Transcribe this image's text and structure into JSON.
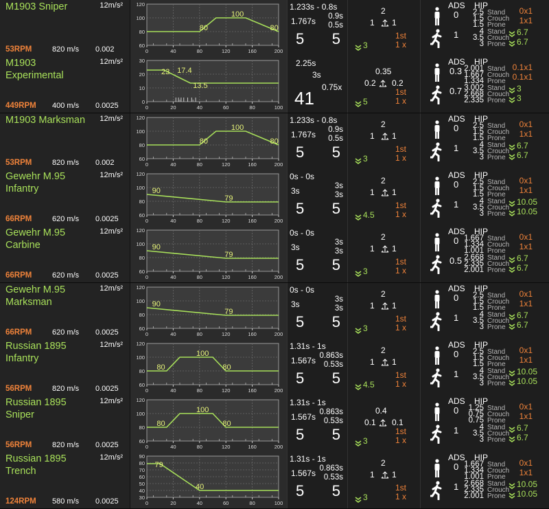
{
  "headers": {
    "ads": "ADS",
    "hip": "HIP",
    "stand": "Stand",
    "crouch": "Crouch",
    "prone": "Prone"
  },
  "weapons": [
    {
      "name": "M1903 Sniper",
      "accel": "12m/s²",
      "rpm": "53RPM",
      "velocity": "820 m/s",
      "drag": "0.002",
      "chart": {
        "xmax": 200,
        "yticks": [
          "120",
          "100",
          "80",
          "60"
        ],
        "xticks": [
          "0",
          "40",
          "80",
          "120",
          "160",
          "200"
        ],
        "ymin": 60,
        "ymax": 120,
        "points": [
          [
            0,
            80
          ],
          [
            80,
            80
          ],
          [
            105,
            100
          ],
          [
            150,
            100
          ],
          [
            200,
            80
          ]
        ],
        "labels": [
          {
            "text": "80",
            "x": 80,
            "y": 80
          },
          {
            "text": "100",
            "x": 128,
            "y": 100
          },
          {
            "text": "80",
            "x": 187,
            "y": 80
          }
        ],
        "minor": []
      },
      "dmg": {
        "reload": "1.233s - 0.8s",
        "deploy": "1.767s",
        "a": "0.9s",
        "b": "0.5s",
        "mag": "5",
        "ammo": "5"
      },
      "recoil": {
        "up": "2",
        "left": "1",
        "right": "1",
        "first_shot": "1st",
        "first_mult": "1 x",
        "chevron_val": "3"
      },
      "spread": {
        "ads_stand": "0",
        "ads_move": "1",
        "hip": [
          [
            "2.5",
            "1.5",
            "1.5"
          ],
          [
            "4",
            "3.5",
            "3"
          ]
        ],
        "inc_stand": "0x1",
        "inc_crouch": "1x1",
        "inc_move_a": "6.7",
        "inc_move_b": "6.7"
      }
    },
    {
      "name": "M1903\nExperimental",
      "accel": "12m/s²",
      "rpm": "449RPM",
      "velocity": "400 m/s",
      "drag": "0.0025",
      "chart": {
        "xmax": 100,
        "yticks": [
          "30",
          "20",
          "10",
          "0"
        ],
        "xticks": [
          "0",
          "20",
          "40",
          "60",
          "80",
          "100"
        ],
        "ymin": 0,
        "ymax": 30,
        "points": [
          [
            0,
            23
          ],
          [
            13,
            23
          ],
          [
            33,
            13.5
          ],
          [
            100,
            13.5
          ]
        ],
        "labels": [
          {
            "text": "23",
            "x": 11,
            "y": 19
          },
          {
            "text": "17.4",
            "x": 23,
            "y": 20
          },
          {
            "text": "13.5",
            "x": 35,
            "y": 9
          }
        ],
        "minor": [
          22,
          24,
          26,
          28,
          31,
          34,
          37
        ]
      },
      "dmg": {
        "reload": "2.25s",
        "deploy": "3s",
        "a": "41",
        "b": "0.75x",
        "mag": "",
        "ammo": ""
      },
      "recoil": {
        "up": "0.35",
        "left": "0.2",
        "right": "0.2",
        "first_shot": "1st",
        "first_mult": "1 x",
        "chevron_val": "5"
      },
      "spread": {
        "ads_stand": "0.3",
        "ads_move": "0.7",
        "hip": [
          [
            "2.001",
            "1.667",
            "1.334"
          ],
          [
            "3.002",
            "2.668",
            "2.335"
          ]
        ],
        "inc_stand": "0.1x1",
        "inc_crouch": "0.1x1",
        "inc_move_a": "3",
        "inc_move_b": "3"
      }
    },
    {
      "name": "M1903 Marksman",
      "accel": "12m/s²",
      "rpm": "53RPM",
      "velocity": "820 m/s",
      "drag": "0.002",
      "chart": {
        "xmax": 200,
        "yticks": [
          "120",
          "100",
          "80",
          "60"
        ],
        "xticks": [
          "0",
          "40",
          "80",
          "120",
          "160",
          "200"
        ],
        "ymin": 60,
        "ymax": 120,
        "points": [
          [
            0,
            80
          ],
          [
            80,
            80
          ],
          [
            105,
            100
          ],
          [
            150,
            100
          ],
          [
            200,
            80
          ]
        ],
        "labels": [
          {
            "text": "80",
            "x": 80,
            "y": 80
          },
          {
            "text": "100",
            "x": 128,
            "y": 100
          },
          {
            "text": "80",
            "x": 187,
            "y": 80
          }
        ],
        "minor": []
      },
      "dmg": {
        "reload": "1.233s - 0.8s",
        "deploy": "1.767s",
        "a": "0.9s",
        "b": "0.5s",
        "mag": "5",
        "ammo": "5"
      },
      "recoil": {
        "up": "2",
        "left": "1",
        "right": "1",
        "first_shot": "1st",
        "first_mult": "1 x",
        "chevron_val": "3"
      },
      "spread": {
        "ads_stand": "0",
        "ads_move": "1",
        "hip": [
          [
            "2.5",
            "1.5",
            "1.5"
          ],
          [
            "4",
            "3.5",
            "3"
          ]
        ],
        "inc_stand": "0x1",
        "inc_crouch": "1x1",
        "inc_move_a": "6.7",
        "inc_move_b": "6.7"
      }
    },
    {
      "name": "Gewehr M.95\nInfantry",
      "accel": "12m/s²",
      "rpm": "66RPM",
      "velocity": "620 m/s",
      "drag": "0.0025",
      "chart": {
        "xmax": 200,
        "yticks": [
          "120",
          "100",
          "80",
          "60"
        ],
        "xticks": [
          "0",
          "40",
          "80",
          "120",
          "160",
          "200"
        ],
        "ymin": 60,
        "ymax": 120,
        "points": [
          [
            0,
            90
          ],
          [
            120,
            79
          ],
          [
            200,
            79
          ]
        ],
        "labels": [
          {
            "text": "90",
            "x": 8,
            "y": 90
          },
          {
            "text": "79",
            "x": 118,
            "y": 79
          }
        ],
        "minor": []
      },
      "dmg": {
        "reload": "0s - 0s",
        "deploy": "3s",
        "a": "3s",
        "b": "3s",
        "mag": "5",
        "ammo": "5"
      },
      "recoil": {
        "up": "2",
        "left": "1",
        "right": "1",
        "first_shot": "1st",
        "first_mult": "1 x",
        "chevron_val": "4.5"
      },
      "spread": {
        "ads_stand": "0",
        "ads_move": "1",
        "hip": [
          [
            "2.5",
            "1.5",
            "1.5"
          ],
          [
            "4",
            "3.5",
            "3"
          ]
        ],
        "inc_stand": "0x1",
        "inc_crouch": "1x1",
        "inc_move_a": "10.05",
        "inc_move_b": "10.05"
      }
    },
    {
      "name": "Gewehr M.95\nCarbine",
      "accel": "12m/s²",
      "rpm": "66RPM",
      "velocity": "620 m/s",
      "drag": "0.0025",
      "chart": {
        "xmax": 200,
        "yticks": [
          "120",
          "100",
          "80",
          "60"
        ],
        "xticks": [
          "0",
          "40",
          "80",
          "120",
          "160",
          "200"
        ],
        "ymin": 60,
        "ymax": 120,
        "points": [
          [
            0,
            90
          ],
          [
            120,
            79
          ],
          [
            200,
            79
          ]
        ],
        "labels": [
          {
            "text": "90",
            "x": 8,
            "y": 90
          },
          {
            "text": "79",
            "x": 118,
            "y": 79
          }
        ],
        "minor": []
      },
      "dmg": {
        "reload": "0s - 0s",
        "deploy": "3s",
        "a": "3s",
        "b": "3s",
        "mag": "5",
        "ammo": "5"
      },
      "recoil": {
        "up": "2",
        "left": "1",
        "right": "1",
        "first_shot": "1st",
        "first_mult": "1 x",
        "chevron_val": "3"
      },
      "spread": {
        "ads_stand": "0",
        "ads_move": "0.5",
        "hip": [
          [
            "1.667",
            "1.334",
            "1.001"
          ],
          [
            "2.668",
            "2.335",
            "2.001"
          ]
        ],
        "inc_stand": "0x1",
        "inc_crouch": "1x1",
        "inc_move_a": "6.7",
        "inc_move_b": "6.7"
      }
    },
    {
      "name": "Gewehr M.95\nMarksman",
      "accel": "12m/s²",
      "rpm": "66RPM",
      "velocity": "620 m/s",
      "drag": "0.0025",
      "chart": {
        "xmax": 200,
        "yticks": [
          "120",
          "100",
          "80",
          "60"
        ],
        "xticks": [
          "0",
          "40",
          "80",
          "120",
          "160",
          "200"
        ],
        "ymin": 60,
        "ymax": 120,
        "points": [
          [
            0,
            90
          ],
          [
            120,
            79
          ],
          [
            200,
            79
          ]
        ],
        "labels": [
          {
            "text": "90",
            "x": 8,
            "y": 90
          },
          {
            "text": "79",
            "x": 118,
            "y": 79
          }
        ],
        "minor": []
      },
      "dmg": {
        "reload": "0s - 0s",
        "deploy": "3s",
        "a": "3s",
        "b": "3s",
        "mag": "5",
        "ammo": "5"
      },
      "recoil": {
        "up": "2",
        "left": "1",
        "right": "1",
        "first_shot": "1st",
        "first_mult": "1 x",
        "chevron_val": "3"
      },
      "spread": {
        "ads_stand": "0",
        "ads_move": "1",
        "hip": [
          [
            "2.5",
            "1.5",
            "1.5"
          ],
          [
            "4",
            "3.5",
            "3"
          ]
        ],
        "inc_stand": "0x1",
        "inc_crouch": "1x1",
        "inc_move_a": "6.7",
        "inc_move_b": "6.7"
      }
    },
    {
      "name": "Russian 1895\nInfantry",
      "accel": "12m/s²",
      "rpm": "56RPM",
      "velocity": "820 m/s",
      "drag": "0.0025",
      "chart": {
        "xmax": 200,
        "yticks": [
          "120",
          "100",
          "80",
          "60"
        ],
        "xticks": [
          "0",
          "40",
          "80",
          "120",
          "160",
          "200"
        ],
        "ymin": 60,
        "ymax": 120,
        "points": [
          [
            0,
            80
          ],
          [
            30,
            80
          ],
          [
            50,
            100
          ],
          [
            100,
            100
          ],
          [
            120,
            80
          ],
          [
            200,
            80
          ]
        ],
        "labels": [
          {
            "text": "80",
            "x": 15,
            "y": 80
          },
          {
            "text": "100",
            "x": 75,
            "y": 100
          },
          {
            "text": "80",
            "x": 115,
            "y": 80
          }
        ],
        "minor": []
      },
      "dmg": {
        "reload": "1.31s - 1s",
        "deploy": "1.567s",
        "a": "0.863s",
        "b": "0.53s",
        "mag": "5",
        "ammo": "5"
      },
      "recoil": {
        "up": "2",
        "left": "1",
        "right": "1",
        "first_shot": "1st",
        "first_mult": "1 x",
        "chevron_val": "4.5"
      },
      "spread": {
        "ads_stand": "0",
        "ads_move": "1",
        "hip": [
          [
            "2.5",
            "1.5",
            "1.5"
          ],
          [
            "4",
            "3.5",
            "3"
          ]
        ],
        "inc_stand": "0x1",
        "inc_crouch": "1x1",
        "inc_move_a": "10.05",
        "inc_move_b": "10.05"
      }
    },
    {
      "name": "Russian 1895\nSniper",
      "accel": "12m/s²",
      "rpm": "56RPM",
      "velocity": "820 m/s",
      "drag": "0.0025",
      "chart": {
        "xmax": 200,
        "yticks": [
          "120",
          "100",
          "80",
          "60"
        ],
        "xticks": [
          "0",
          "40",
          "80",
          "120",
          "160",
          "200"
        ],
        "ymin": 60,
        "ymax": 120,
        "points": [
          [
            0,
            80
          ],
          [
            30,
            80
          ],
          [
            50,
            100
          ],
          [
            100,
            100
          ],
          [
            120,
            80
          ],
          [
            200,
            80
          ]
        ],
        "labels": [
          {
            "text": "80",
            "x": 15,
            "y": 80
          },
          {
            "text": "100",
            "x": 75,
            "y": 100
          },
          {
            "text": "80",
            "x": 115,
            "y": 80
          }
        ],
        "minor": []
      },
      "dmg": {
        "reload": "1.31s - 1s",
        "deploy": "1.567s",
        "a": "0.863s",
        "b": "0.53s",
        "mag": "5",
        "ammo": "5"
      },
      "recoil": {
        "up": "0.4",
        "left": "0.1",
        "right": "0.1",
        "first_shot": "1st",
        "first_mult": "1 x",
        "chevron_val": "3"
      },
      "spread": {
        "ads_stand": "0",
        "ads_move": "1",
        "hip": [
          [
            "1.25",
            "0.75",
            "0.75"
          ],
          [
            "4",
            "3.5",
            "3"
          ]
        ],
        "inc_stand": "0x1",
        "inc_crouch": "1x1",
        "inc_move_a": "6.7",
        "inc_move_b": "6.7"
      }
    },
    {
      "name": "Russian 1895\nTrench",
      "accel": "12m/s²",
      "rpm": "124RPM",
      "velocity": "580 m/s",
      "drag": "0.0025",
      "chart": {
        "xmax": 100,
        "yticks": [
          "90",
          "80",
          "70",
          "60",
          "50",
          "40",
          "30"
        ],
        "xticks": [
          "0",
          "20",
          "40",
          "60",
          "80",
          "100"
        ],
        "ymin": 30,
        "ymax": 90,
        "points": [
          [
            0,
            79
          ],
          [
            10,
            79
          ],
          [
            40,
            40
          ],
          [
            100,
            40
          ]
        ],
        "labels": [
          {
            "text": "79",
            "x": 6,
            "y": 72
          },
          {
            "text": "40",
            "x": 37,
            "y": 40
          }
        ],
        "minor": []
      },
      "dmg": {
        "reload": "1.31s - 1s",
        "deploy": "1.567s",
        "a": "0.863s",
        "b": "0.53s",
        "mag": "5",
        "ammo": "5"
      },
      "recoil": {
        "up": "2",
        "left": "1",
        "right": "1",
        "first_shot": "1st",
        "first_mult": "1 x",
        "chevron_val": "3"
      },
      "spread": {
        "ads_stand": "0",
        "ads_move": "1",
        "hip": [
          [
            "1.667",
            "1.334",
            "1.001"
          ],
          [
            "2.668",
            "2.335",
            "2.001"
          ]
        ],
        "inc_stand": "0x1",
        "inc_crouch": "1x1",
        "inc_move_a": "10.05",
        "inc_move_b": "10.05"
      }
    }
  ]
}
